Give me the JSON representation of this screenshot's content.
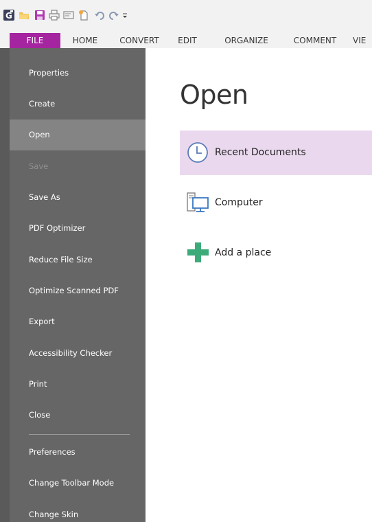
{
  "quick_access": {
    "icons": [
      "app-logo-icon",
      "open-folder-icon",
      "save-icon",
      "print-icon",
      "scan-icon",
      "new-document-icon",
      "undo-icon",
      "redo-icon",
      "customize-toolbar-icon"
    ]
  },
  "ribbon": {
    "tabs": [
      {
        "label": "FILE",
        "active": true
      },
      {
        "label": "HOME"
      },
      {
        "label": "CONVERT"
      },
      {
        "label": "EDIT"
      },
      {
        "label": "ORGANIZE"
      },
      {
        "label": "COMMENT"
      },
      {
        "label": "VIE"
      }
    ],
    "accent_color": "#a4259f"
  },
  "backstage": {
    "items": [
      {
        "label": "Properties"
      },
      {
        "label": "Create"
      },
      {
        "label": "Open",
        "selected": true
      },
      {
        "label": "Save",
        "disabled": true
      },
      {
        "label": "Save As"
      },
      {
        "label": "PDF Optimizer"
      },
      {
        "label": "Reduce File Size"
      },
      {
        "label": "Optimize Scanned PDF"
      },
      {
        "label": "Export"
      },
      {
        "label": "Accessibility Checker"
      },
      {
        "label": "Print"
      },
      {
        "label": "Close"
      },
      {
        "label": "Preferences"
      },
      {
        "label": "Change Toolbar Mode"
      },
      {
        "label": "Change Skin"
      }
    ],
    "background_color": "#666666",
    "selected_color": "#848484"
  },
  "main": {
    "title": "Open",
    "places": [
      {
        "label": "Recent Documents",
        "icon": "clock-icon",
        "highlighted": true
      },
      {
        "label": "Computer",
        "icon": "computer-icon"
      },
      {
        "label": "Add a place",
        "icon": "plus-icon"
      }
    ],
    "highlight_color": "#ead9ee",
    "plus_color": "#3daa7a"
  }
}
